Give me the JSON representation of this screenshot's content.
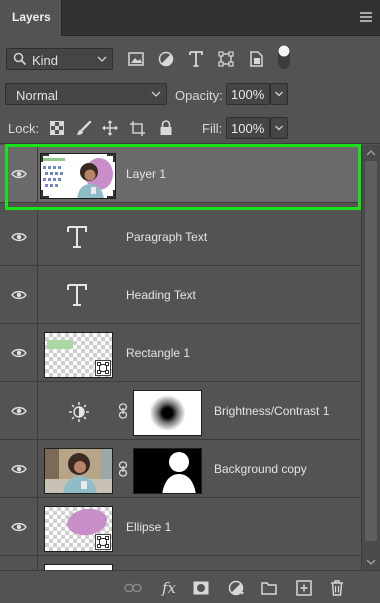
{
  "panel": {
    "tab_title": "Layers",
    "menu_icon": "panel-menu-icon"
  },
  "filter": {
    "kind_label": "Kind",
    "icons": [
      "pixel-filter-icon",
      "adjustment-filter-icon",
      "type-filter-icon",
      "shape-filter-icon",
      "smart-object-filter-icon"
    ],
    "toggle": "filter-toggle"
  },
  "blend": {
    "mode": "Normal",
    "opacity_label": "Opacity:",
    "opacity_value": "100%",
    "fill_label": "Fill:",
    "fill_value": "100%"
  },
  "lock": {
    "label": "Lock:",
    "icons": [
      "lock-transparent-pixels-icon",
      "lock-image-pixels-icon",
      "lock-position-icon",
      "lock-artboard-icon",
      "lock-all-icon"
    ]
  },
  "layers": [
    {
      "name": "Layer 1",
      "type": "smart-object",
      "visible": true,
      "selected": true
    },
    {
      "name": "Paragraph Text",
      "type": "text",
      "visible": true,
      "selected": false
    },
    {
      "name": "Heading Text",
      "type": "text",
      "visible": true,
      "selected": false
    },
    {
      "name": "Rectangle 1",
      "type": "shape",
      "visible": true,
      "selected": false
    },
    {
      "name": "Brightness/Contrast 1",
      "type": "adjustment",
      "visible": true,
      "selected": false
    },
    {
      "name": "Background copy",
      "type": "pixel-masked",
      "visible": true,
      "selected": false
    },
    {
      "name": "Ellipse 1",
      "type": "shape",
      "visible": true,
      "selected": false
    }
  ],
  "footer": {
    "icons": [
      "link-layers-icon",
      "fx-icon",
      "add-mask-icon",
      "new-adjustment-icon",
      "new-group-icon",
      "new-layer-icon",
      "delete-layer-icon"
    ],
    "fx_label": "fx"
  },
  "colors": {
    "panel_bg": "#535353",
    "selected_row": "#6a6a6a",
    "highlight": "#19e21b",
    "rectangle_fill": "#a9d9a0",
    "ellipse_fill": "#c88ec8"
  }
}
